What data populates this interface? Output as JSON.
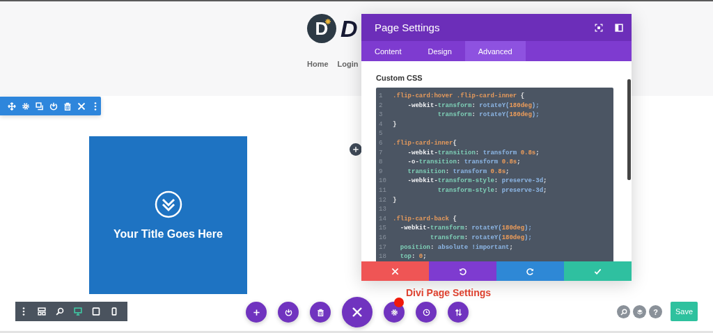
{
  "site": {
    "logo_mark": "D",
    "logo_text": "D",
    "nav": [
      {
        "label": "Home"
      },
      {
        "label": "Login"
      }
    ]
  },
  "module": {
    "title": "Your Title Goes Here"
  },
  "modal": {
    "title": "Page Settings",
    "tabs": [
      {
        "label": "Content",
        "selected": false
      },
      {
        "label": "Design",
        "selected": false
      },
      {
        "label": "Advanced",
        "selected": true
      }
    ],
    "field_label": "Custom CSS",
    "code": [
      {
        "number": "1",
        "tokens": [
          {
            "kind": "sel",
            "text": ".flip-card:hover .flip-card-inner "
          },
          {
            "kind": "pun",
            "text": "{"
          }
        ]
      },
      {
        "number": "2",
        "tokens": [
          {
            "kind": "pre",
            "text": "    -webkit-"
          },
          {
            "kind": "prop",
            "text": "transform"
          },
          {
            "kind": "pun",
            "text": ": "
          },
          {
            "kind": "val",
            "text": "rotateY("
          },
          {
            "kind": "num",
            "text": "180deg"
          },
          {
            "kind": "val",
            "text": ");"
          }
        ]
      },
      {
        "number": "3",
        "tokens": [
          {
            "kind": "prop",
            "text": "            transform"
          },
          {
            "kind": "pun",
            "text": ": "
          },
          {
            "kind": "val",
            "text": "rotateY("
          },
          {
            "kind": "num",
            "text": "180deg"
          },
          {
            "kind": "val",
            "text": ");"
          }
        ]
      },
      {
        "number": "4",
        "tokens": [
          {
            "kind": "pun",
            "text": "}"
          }
        ]
      },
      {
        "number": "5"
      },
      {
        "number": "6",
        "tokens": [
          {
            "kind": "sel",
            "text": ".flip-card-inner"
          },
          {
            "kind": "pun",
            "text": "{"
          }
        ]
      },
      {
        "number": "7",
        "tokens": [
          {
            "kind": "pre",
            "text": "    -webkit-"
          },
          {
            "kind": "prop",
            "text": "transition"
          },
          {
            "kind": "pun",
            "text": ": "
          },
          {
            "kind": "val",
            "text": "transform "
          },
          {
            "kind": "num",
            "text": "0.8s"
          },
          {
            "kind": "pun",
            "text": ";"
          }
        ]
      },
      {
        "number": "8",
        "tokens": [
          {
            "kind": "pre",
            "text": "    -o-"
          },
          {
            "kind": "prop",
            "text": "transition"
          },
          {
            "kind": "pun",
            "text": ": "
          },
          {
            "kind": "val",
            "text": "transform "
          },
          {
            "kind": "num",
            "text": "0.8s"
          },
          {
            "kind": "pun",
            "text": ";"
          }
        ]
      },
      {
        "number": "9",
        "tokens": [
          {
            "kind": "prop",
            "text": "    transition"
          },
          {
            "kind": "pun",
            "text": ": "
          },
          {
            "kind": "val",
            "text": "transform "
          },
          {
            "kind": "num",
            "text": "0.8s"
          },
          {
            "kind": "pun",
            "text": ";"
          }
        ]
      },
      {
        "number": "10",
        "tokens": [
          {
            "kind": "pre",
            "text": "    -webkit-"
          },
          {
            "kind": "prop",
            "text": "transform-style"
          },
          {
            "kind": "pun",
            "text": ": "
          },
          {
            "kind": "val",
            "text": "preserve-3d"
          },
          {
            "kind": "pun",
            "text": ";"
          }
        ]
      },
      {
        "number": "11",
        "tokens": [
          {
            "kind": "prop",
            "text": "            transform-style"
          },
          {
            "kind": "pun",
            "text": ": "
          },
          {
            "kind": "val",
            "text": "preserve-3d"
          },
          {
            "kind": "pun",
            "text": ";"
          }
        ]
      },
      {
        "number": "12",
        "tokens": [
          {
            "kind": "pun",
            "text": "}"
          }
        ]
      },
      {
        "number": "13"
      },
      {
        "number": "14",
        "tokens": [
          {
            "kind": "sel",
            "text": ".flip-card-back "
          },
          {
            "kind": "pun",
            "text": "{"
          }
        ]
      },
      {
        "number": "15",
        "tokens": [
          {
            "kind": "pre",
            "text": "  -webkit-"
          },
          {
            "kind": "prop",
            "text": "transform"
          },
          {
            "kind": "pun",
            "text": ": "
          },
          {
            "kind": "val",
            "text": "rotateY("
          },
          {
            "kind": "num",
            "text": "180deg"
          },
          {
            "kind": "val",
            "text": ");"
          }
        ]
      },
      {
        "number": "16",
        "tokens": [
          {
            "kind": "prop",
            "text": "          transform"
          },
          {
            "kind": "pun",
            "text": ": "
          },
          {
            "kind": "val",
            "text": "rotateY("
          },
          {
            "kind": "num",
            "text": "180deg"
          },
          {
            "kind": "val",
            "text": ");"
          }
        ]
      },
      {
        "number": "17",
        "tokens": [
          {
            "kind": "prop",
            "text": "  position"
          },
          {
            "kind": "pun",
            "text": ": "
          },
          {
            "kind": "val",
            "text": "absolute !important"
          },
          {
            "kind": "pun",
            "text": ";"
          }
        ]
      },
      {
        "number": "18",
        "tokens": [
          {
            "kind": "prop",
            "text": "  top"
          },
          {
            "kind": "pun",
            "text": ": "
          },
          {
            "kind": "num",
            "text": "0"
          },
          {
            "kind": "pun",
            "text": ";"
          }
        ]
      }
    ],
    "actions": [
      {
        "kind": "cancel",
        "color": "#ef5555"
      },
      {
        "kind": "undo",
        "color": "#7e3bd0"
      },
      {
        "kind": "redo",
        "color": "#2e88d6"
      },
      {
        "kind": "save",
        "color": "#2fc0a0"
      }
    ]
  },
  "view_modes": [
    {
      "kind": "desktop",
      "selected": true
    },
    {
      "kind": "tablet",
      "selected": false
    },
    {
      "kind": "phone",
      "selected": false
    }
  ],
  "callout": {
    "text": "Divi Page Settings"
  },
  "help_button": {
    "label": "?"
  },
  "save_button": {
    "label": "Save"
  }
}
